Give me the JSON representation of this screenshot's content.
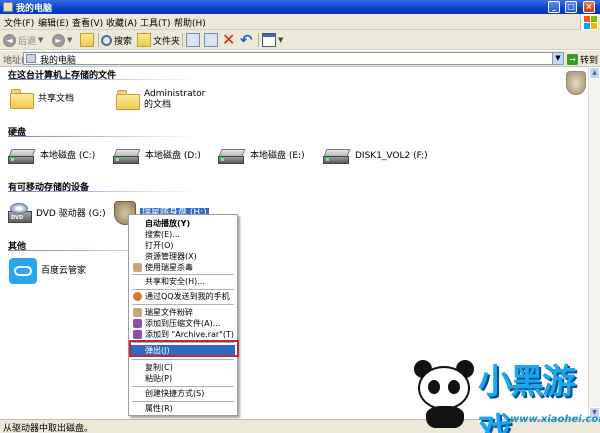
{
  "window": {
    "title": "我的电脑"
  },
  "menu": [
    "文件(F)",
    "编辑(E)",
    "查看(V)",
    "收藏(A)",
    "工具(T)",
    "帮助(H)"
  ],
  "toolbar": {
    "back": "后退",
    "search": "搜索",
    "folders": "文件夹"
  },
  "address": {
    "label": "地址(D)",
    "value": "我的电脑",
    "go": "转到"
  },
  "sections": {
    "stored": "在这台计算机上存储的文件",
    "hdd": "硬盘",
    "removable": "有可移动存储的设备",
    "other": "其他"
  },
  "stored_items": [
    "共享文档",
    "Administrator 的文档"
  ],
  "drives": [
    "本地磁盘 (C:)",
    "本地磁盘 (D:)",
    "本地磁盘 (E:)",
    "DISK1_VOL2 (F:)"
  ],
  "removable_items": {
    "dvd": "DVD 驱动器 (G:)",
    "usb": "瑞星随身盘 (H:)"
  },
  "other_items": [
    "百度云管家"
  ],
  "context_menu": [
    "自动播放(Y)",
    "搜索(E)...",
    "打开(O)",
    "资源管理器(X)",
    "使用瑞星杀毒",
    "共享和安全(H)...",
    "通过QQ发送到我的手机",
    "瑞星文件粉碎",
    "添加到压缩文件(A)...",
    "添加到 \"Archive.rar\"(T)",
    "弹出(J)",
    "复制(C)",
    "粘贴(P)",
    "创建快捷方式(S)",
    "属性(R)"
  ],
  "status": "从驱动器中取出磁盘。",
  "watermark": {
    "title": "小黑游戏",
    "url": "www.xiaohei.com"
  }
}
